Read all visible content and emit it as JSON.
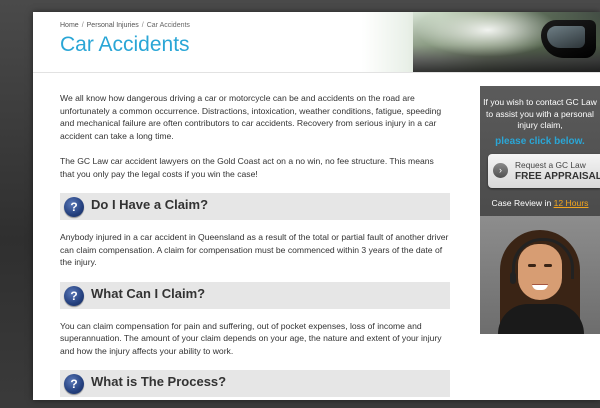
{
  "breadcrumb": {
    "home": "Home",
    "personal_injuries": "Personal Injuries",
    "current": "Car Accidents",
    "separator": "/"
  },
  "page_title": "Car Accidents",
  "intro": {
    "p1": "We all know how dangerous driving a car or motorcycle can be and accidents on the road are unfortunately a common occurrence. Distractions, intoxication, weather conditions, fatigue, speeding and mechanical failure are often contributors to car accidents. Recovery from serious injury in a car accident can take a long time.",
    "p2": "The GC Law car accident lawyers on the Gold Coast act on a no win, no fee structure. This means that you only pay the legal costs if you win the case!"
  },
  "sections": [
    {
      "icon": "?",
      "heading": "Do I Have a Claim?",
      "body": "Anybody injured in a car accident in Queensland as a result of the total or partial fault of another driver can claim compensation. A claim for compensation must be commenced within 3 years of the date of the injury."
    },
    {
      "icon": "?",
      "heading": "What Can I Claim?",
      "body": "You can claim compensation for pain and suffering, out of pocket expenses, loss of income and superannuation. The amount of your claim depends on your age, the nature and extent of your injury and how the injury affects your ability to work."
    },
    {
      "icon": "?",
      "heading": "What is The Process?",
      "body": ""
    }
  ],
  "sidebar": {
    "contact_text": "If you wish to contact GC Law to assist you with a personal injury claim,",
    "cta_link": "please click below.",
    "appraisal_line1": "Request a GC Law",
    "appraisal_line2": "FREE APPRAISAL",
    "appraisal_arrow": "›",
    "review_prefix": "Case Review in",
    "review_highlight": "12 Hours"
  },
  "colors": {
    "accent": "#2aa6d6",
    "highlight": "#f3a51d",
    "sidebar_bg": "#4a4a4a",
    "section_bg": "#e6e6e6"
  }
}
